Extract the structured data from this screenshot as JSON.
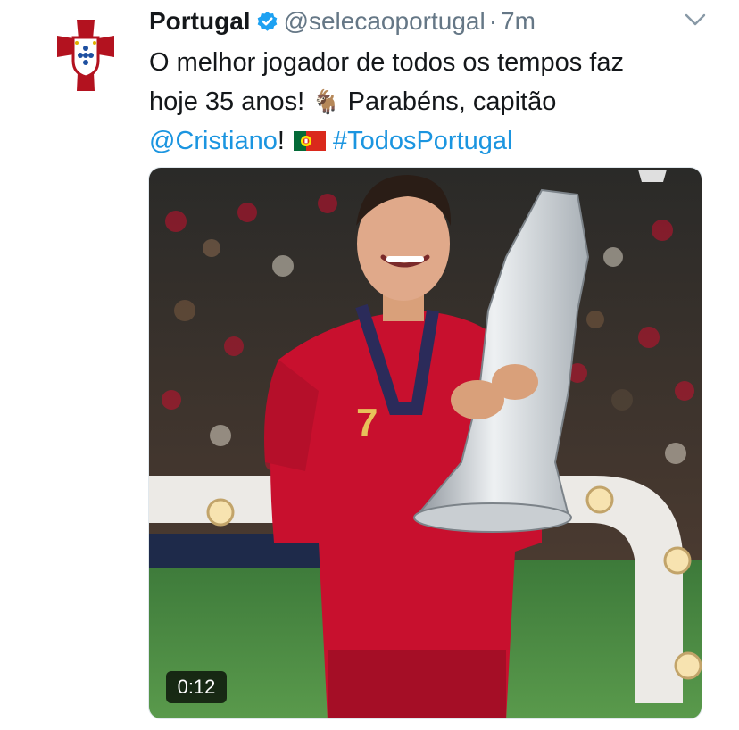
{
  "tweet": {
    "display_name": "Portugal",
    "handle": "@selecaoportugal",
    "separator": "·",
    "time": "7m",
    "text_line1": "O melhor jogador de todos os tempos faz",
    "text_line2_part1": "hoje 35 anos! ",
    "emoji_goat": "🐐",
    "text_line2_part2": "  Parabéns, capitão",
    "mention": "@Cristiano",
    "after_mention": "!",
    "hashtag": "#TodosPortugal",
    "video_duration": "0:12"
  },
  "icons": {
    "avatar": "fpf-crest-icon",
    "verified": "verified-badge-icon",
    "menu": "chevron-down-icon",
    "flag": "portugal-flag-icon"
  },
  "colors": {
    "link": "#1b95e0",
    "verified": "#1da1f2",
    "secondary_text": "#657786",
    "jersey_red": "#c8102e"
  }
}
